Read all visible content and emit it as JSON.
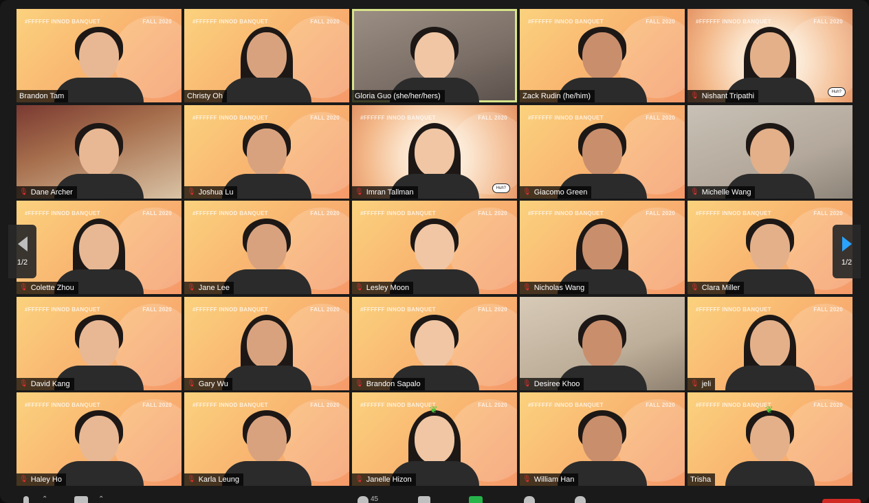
{
  "banner": {
    "left": "#FFFFFF INNOD BANQUET",
    "right": "FALL 2020"
  },
  "navigation": {
    "prev_page": "1/2",
    "next_page": "1/2"
  },
  "participants": [
    {
      "name": "Brandon Tam",
      "muted": false,
      "bg": "banner",
      "active": false
    },
    {
      "name": "Christy Oh",
      "muted": false,
      "bg": "banner",
      "active": false
    },
    {
      "name": "Gloria Guo (she/her/hers)",
      "muted": false,
      "bg": "room",
      "active": true
    },
    {
      "name": "Zack Rudin (he/him)",
      "muted": false,
      "bg": "banner",
      "active": false
    },
    {
      "name": "Nishant Tripathi",
      "muted": true,
      "bg": "comic",
      "active": false,
      "sticker": "Huh?"
    },
    {
      "name": "Dane Archer",
      "muted": true,
      "bg": "dogs",
      "active": false
    },
    {
      "name": "Joshua Lu",
      "muted": true,
      "bg": "banner",
      "active": false
    },
    {
      "name": "Imran Tallman",
      "muted": true,
      "bg": "comic",
      "active": false,
      "sticker": "Huh?"
    },
    {
      "name": "Giacomo Green",
      "muted": true,
      "bg": "banner",
      "active": false
    },
    {
      "name": "Michelle Wang",
      "muted": true,
      "bg": "room2",
      "active": false
    },
    {
      "name": "Colette Zhou",
      "muted": true,
      "bg": "banner",
      "active": false
    },
    {
      "name": "Jane Lee",
      "muted": true,
      "bg": "banner",
      "active": false
    },
    {
      "name": "Lesley Moon",
      "muted": true,
      "bg": "banner",
      "active": false
    },
    {
      "name": "Nicholas Wang",
      "muted": true,
      "bg": "banner",
      "active": false
    },
    {
      "name": "Clara Miller",
      "muted": true,
      "bg": "banner",
      "active": false
    },
    {
      "name": "David Kang",
      "muted": true,
      "bg": "banner",
      "active": false
    },
    {
      "name": "Gary Wu",
      "muted": true,
      "bg": "banner",
      "active": false
    },
    {
      "name": "Brandon Sapalo",
      "muted": true,
      "bg": "banner",
      "active": false
    },
    {
      "name": "Desiree Khoo",
      "muted": true,
      "bg": "room3",
      "active": false
    },
    {
      "name": "jeli",
      "muted": true,
      "bg": "banner",
      "active": false
    },
    {
      "name": "Haley Ho",
      "muted": true,
      "bg": "banner",
      "active": false
    },
    {
      "name": "Karla Leung",
      "muted": true,
      "bg": "banner",
      "active": false
    },
    {
      "name": "Janelle Hizon",
      "muted": true,
      "bg": "banner",
      "active": false,
      "sprout": true
    },
    {
      "name": "William Han",
      "muted": true,
      "bg": "banner",
      "active": false
    },
    {
      "name": "Trisha",
      "muted": false,
      "bg": "banner",
      "active": false,
      "sprout": true
    }
  ],
  "toolbar": {
    "participant_count": "45"
  },
  "colors": {
    "accent": "#2aa3ff",
    "active_border": "#d9e48a",
    "muted_mic": "#e0302f",
    "share_green": "#26b34a",
    "end_red": "#d12a24"
  }
}
